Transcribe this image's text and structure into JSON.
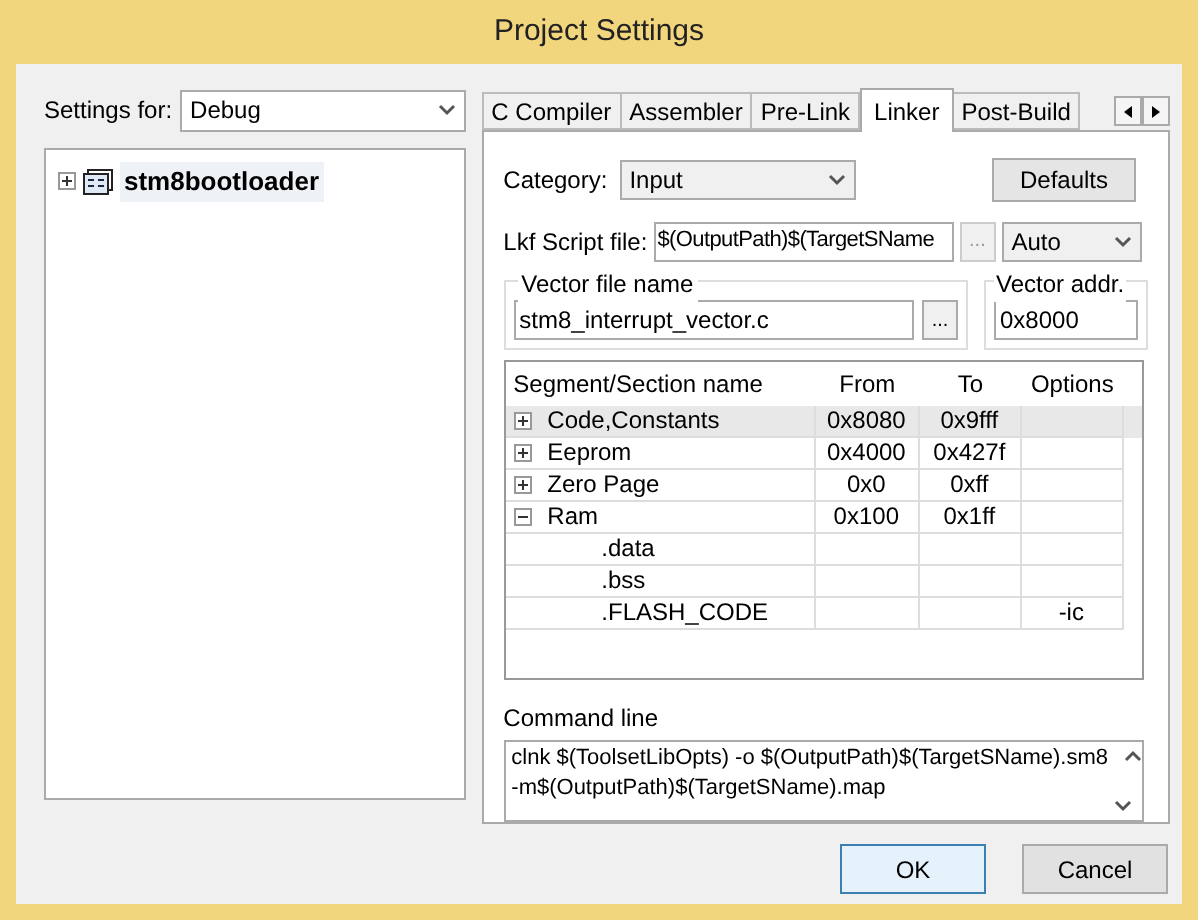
{
  "window": {
    "title": "Project Settings"
  },
  "settings_for": {
    "label": "Settings for:",
    "value": "Debug"
  },
  "project_tree": [
    {
      "label": "stm8bootloader",
      "expanded": false
    }
  ],
  "tabs": [
    {
      "label": "C Compiler",
      "selected": false
    },
    {
      "label": "Assembler",
      "selected": false
    },
    {
      "label": "Pre-Link",
      "selected": false
    },
    {
      "label": "Linker",
      "selected": true
    },
    {
      "label": "Post-Build",
      "selected": false
    }
  ],
  "category": {
    "label": "Category:",
    "value": "Input"
  },
  "defaults_button": "Defaults",
  "lkf_script": {
    "label": "Lkf Script file:",
    "value": "$(OutputPath)$(TargetSName",
    "browse": "...",
    "mode": "Auto"
  },
  "vector_file": {
    "label": "Vector file name",
    "value": "stm8_interrupt_vector.c",
    "browse": "..."
  },
  "vector_addr": {
    "label": "Vector addr.",
    "value": "0x8000"
  },
  "segments": {
    "columns": [
      "Segment/Section name",
      "From",
      "To",
      "Options"
    ],
    "rows": [
      {
        "name": "Code,Constants",
        "from": "0x8080",
        "to": "0x9fff",
        "expanded": false,
        "selected": true
      },
      {
        "name": "Eeprom",
        "from": "0x4000",
        "to": "0x427f",
        "expanded": false,
        "selected": false
      },
      {
        "name": "Zero Page",
        "from": "0x0",
        "to": "0xff",
        "expanded": false,
        "selected": false
      },
      {
        "name": "Ram",
        "from": "0x100",
        "to": "0x1ff",
        "expanded": true,
        "selected": false,
        "children": [
          {
            "name": ".data"
          },
          {
            "name": ".bss"
          },
          {
            "name": ".FLASH_CODE",
            "options": "-ic"
          }
        ]
      }
    ]
  },
  "command_line": {
    "label": "Command line",
    "value": "clnk $(ToolsetLibOpts) -o $(OutputPath)$(TargetSName).sm8\n-m$(OutputPath)$(TargetSName).map"
  },
  "buttons": [
    "OK",
    "Cancel"
  ]
}
